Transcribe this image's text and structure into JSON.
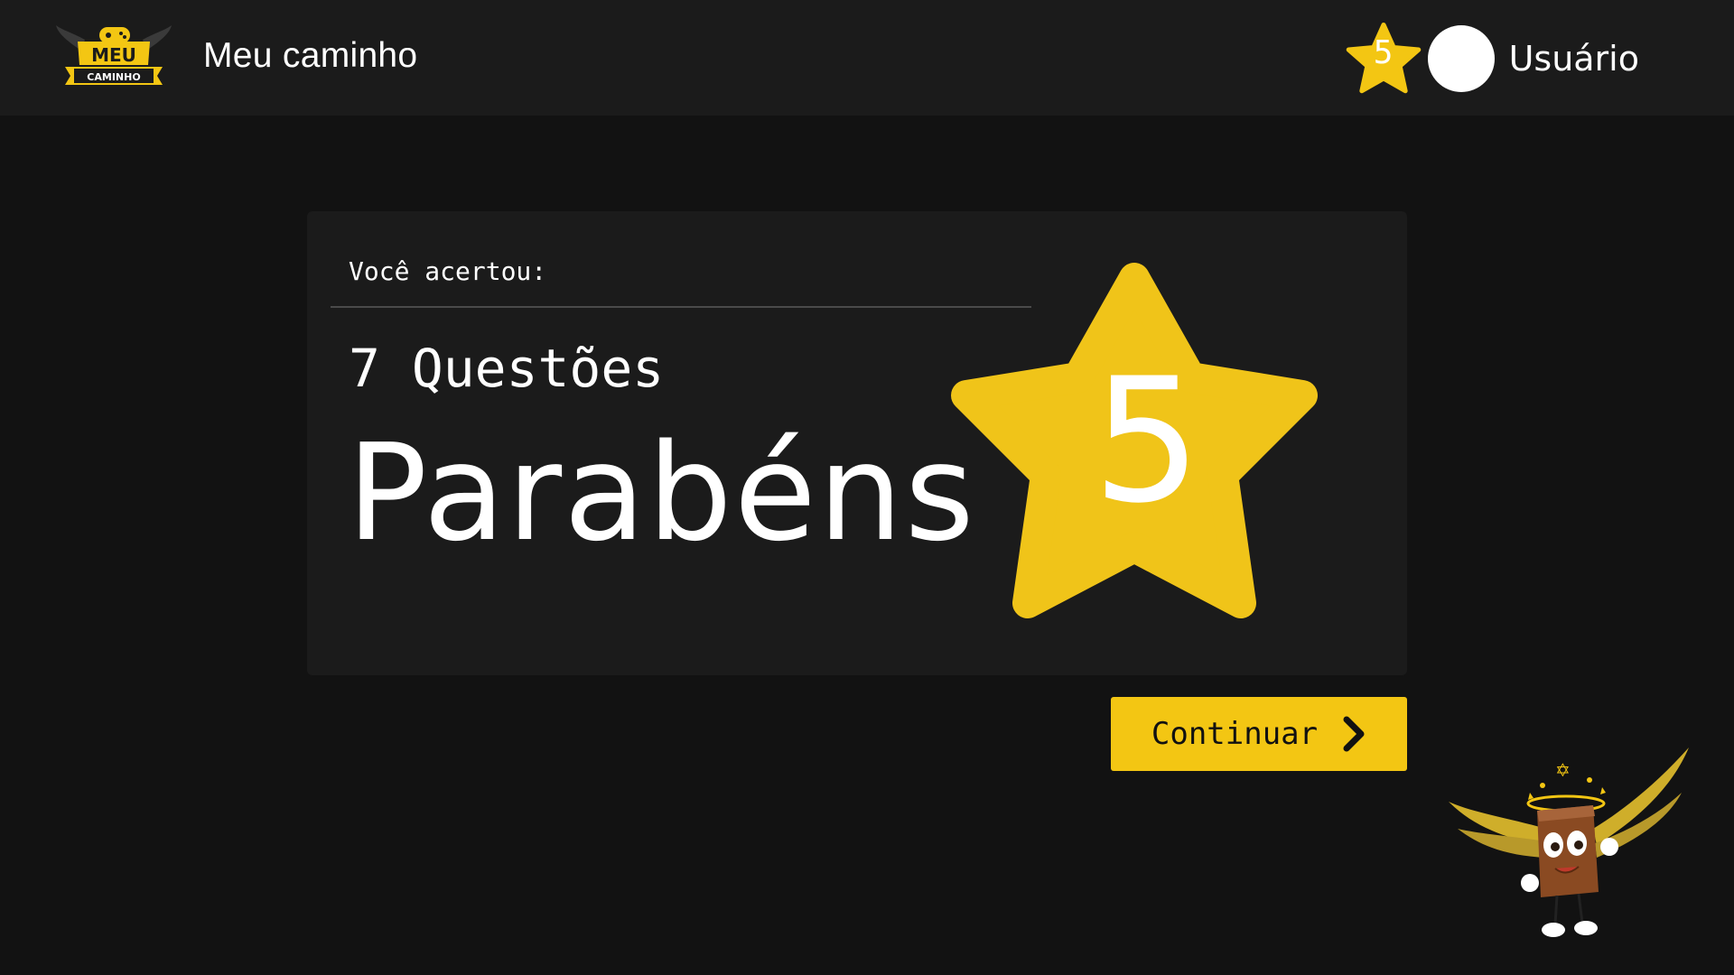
{
  "header": {
    "logo_top": "MEU",
    "logo_bottom": "CAMINHO",
    "title": "Meu caminho",
    "star_count": "5",
    "user_name": "Usuário"
  },
  "result": {
    "label": "Você acertou:",
    "score_text": "7 Questões",
    "message": "Parabéns",
    "stars": "5"
  },
  "actions": {
    "continue_label": "Continuar"
  },
  "colors": {
    "accent": "#f3c613",
    "background": "#121212",
    "surface": "#1b1b1b"
  },
  "icons": {
    "logo": "game-controller-logo-icon",
    "badge": "star-icon",
    "continue": "chevron-right-icon",
    "mascot": "winged-book-mascot-icon"
  }
}
